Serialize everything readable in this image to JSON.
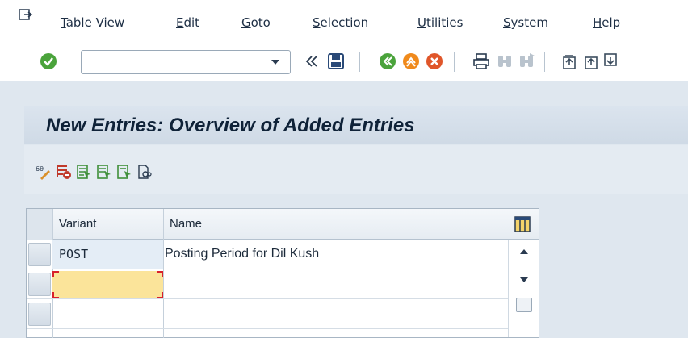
{
  "menu": {
    "items": [
      {
        "id": "table-view",
        "label": "Table View"
      },
      {
        "id": "edit",
        "label": "Edit"
      },
      {
        "id": "goto",
        "label": "Goto"
      },
      {
        "id": "selection",
        "label": "Selection"
      },
      {
        "id": "utilities",
        "label": "Utilities"
      },
      {
        "id": "system",
        "label": "System"
      },
      {
        "id": "help",
        "label": "Help"
      }
    ]
  },
  "toolbar": {
    "command_value": "",
    "icons": [
      "enter-icon",
      "dropdown-icon",
      "back-double-chevron-icon",
      "save-icon",
      "back-icon",
      "exit-icon",
      "cancel-icon",
      "print-icon",
      "find-icon",
      "find-next-icon",
      "first-page-icon",
      "previous-page-icon",
      "next-page-icon"
    ]
  },
  "page": {
    "title": "New Entries: Overview of Added Entries"
  },
  "app_toolbar": {
    "icons": [
      "change-display-icon",
      "delete-row-icon",
      "select-all-icon",
      "select-block-icon",
      "deselect-all-icon",
      "copy-as-icon"
    ]
  },
  "table": {
    "columns": [
      "Variant",
      "Name"
    ],
    "rows": [
      {
        "variant": "POST",
        "name": "Posting Period for Dil Kush"
      },
      {
        "variant": "",
        "name": ""
      },
      {
        "variant": "",
        "name": ""
      }
    ]
  },
  "colors": {
    "accent_green": "#4aa33b",
    "active_cell": "#fbe49a",
    "cell_marker": "#d8202b",
    "title_bg": "#cfdae6"
  }
}
